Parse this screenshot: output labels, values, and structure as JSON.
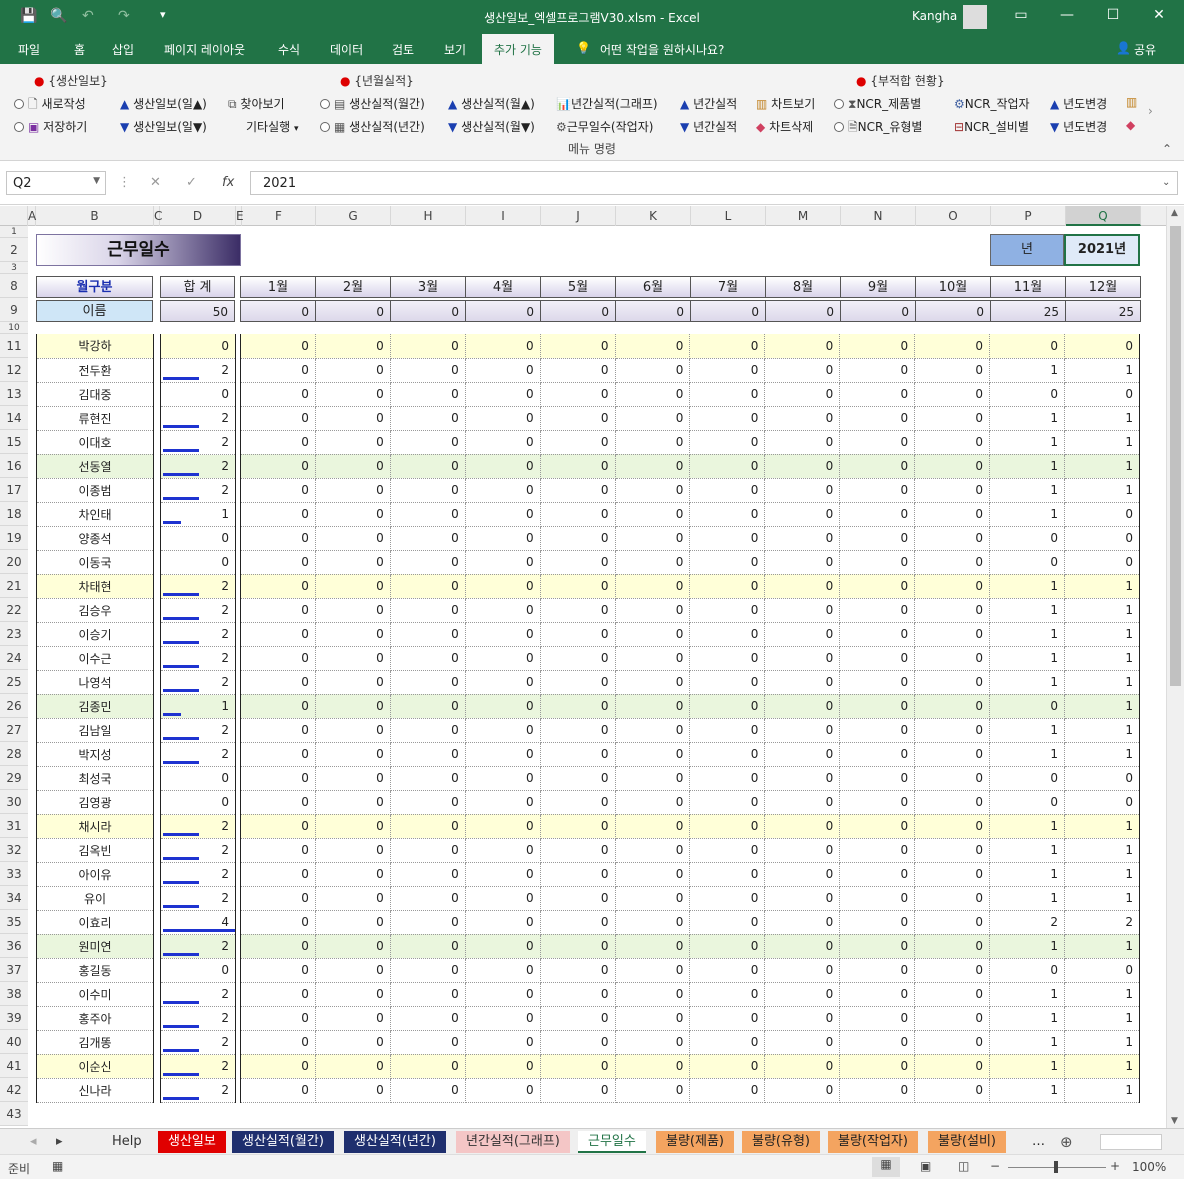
{
  "window": {
    "title": "생산일보_엑셀프로그램V30.xlsm - Excel",
    "user": "Kangha",
    "colors": {
      "excel_green": "#217346",
      "bar_blue": "#1e33d0",
      "highlight_yellow": "#ffffd8",
      "highlight_green": "#eaf6dd"
    }
  },
  "tabs": [
    "파일",
    "홈",
    "삽입",
    "페이지 레이아웃",
    "수식",
    "데이터",
    "검토",
    "보기",
    "추가 기능"
  ],
  "tell_me": "어떤 작업을 원하시나요?",
  "share": "공유",
  "ribbon": {
    "group1_title": "{생산일보}",
    "group2_title": "{년월실적}",
    "group3_title": "{부적합 현황}",
    "new_doc": "새로작성",
    "save": "저장하기",
    "daily_up": "생산일보(일▲)",
    "daily_down": "생산일보(일▼)",
    "find": "찾아보기",
    "other_run": "기타실행",
    "monthly_perf": "생산실적(월간)",
    "yearly_perf": "생산실적(년간)",
    "perf_month_up": "생산실적(월▲)",
    "perf_month_down": "생산실적(월▼)",
    "yearly_graph": "년간실적(그래프)",
    "workdays": "근무일수(작업자)",
    "yearly_up": "년간실적",
    "yearly_down": "년간실적",
    "chart_view": "차트보기",
    "chart_delete": "차트삭제",
    "ncr_product": "NCR_제품별",
    "ncr_type": "NCR_유형별",
    "ncr_worker": "NCR_작업자",
    "ncr_equipment": "NCR_설비별",
    "year_change_up": "년도변경",
    "year_change_down": "년도변경",
    "caption": "메뉴 명령"
  },
  "formula_bar": {
    "name_box": "Q2",
    "value": "2021"
  },
  "columns": [
    "A",
    "B",
    "C",
    "D",
    "E",
    "F",
    "G",
    "H",
    "I",
    "J",
    "K",
    "L",
    "M",
    "N",
    "O",
    "P",
    "Q"
  ],
  "row_numbers": [
    "1",
    "2",
    "3",
    "8",
    "9",
    "10",
    "11",
    "12",
    "13",
    "14",
    "15",
    "16",
    "17",
    "18",
    "19",
    "20",
    "21",
    "22",
    "23",
    "24",
    "25",
    "26",
    "27",
    "28",
    "29",
    "30",
    "31",
    "32",
    "33",
    "34",
    "35",
    "36",
    "37",
    "38",
    "39",
    "40",
    "41",
    "42",
    "43"
  ],
  "sheet": {
    "title": "근무일수",
    "year_label": "년",
    "year_value": "2021년",
    "header_name": "월구분",
    "header_name_sub": "이름",
    "header_total": "합  계",
    "total_sum": "50",
    "months": [
      "1월",
      "2월",
      "3월",
      "4월",
      "5월",
      "6월",
      "7월",
      "8월",
      "9월",
      "10월",
      "11월",
      "12월"
    ],
    "month_totals": [
      "0",
      "0",
      "0",
      "0",
      "0",
      "0",
      "0",
      "0",
      "0",
      "0",
      "25",
      "25"
    ],
    "rows": [
      {
        "name": "박강하",
        "total": 0,
        "nov": 0,
        "dec": 0
      },
      {
        "name": "전두환",
        "total": 2,
        "nov": 1,
        "dec": 1
      },
      {
        "name": "김대중",
        "total": 0,
        "nov": 0,
        "dec": 0
      },
      {
        "name": "류현진",
        "total": 2,
        "nov": 1,
        "dec": 1
      },
      {
        "name": "이대호",
        "total": 2,
        "nov": 1,
        "dec": 1
      },
      {
        "name": "선동열",
        "total": 2,
        "nov": 1,
        "dec": 1
      },
      {
        "name": "이종범",
        "total": 2,
        "nov": 1,
        "dec": 1
      },
      {
        "name": "차인태",
        "total": 1,
        "nov": 1,
        "dec": 0
      },
      {
        "name": "양종석",
        "total": 0,
        "nov": 0,
        "dec": 0
      },
      {
        "name": "이동국",
        "total": 0,
        "nov": 0,
        "dec": 0
      },
      {
        "name": "차태현",
        "total": 2,
        "nov": 1,
        "dec": 1
      },
      {
        "name": "김승우",
        "total": 2,
        "nov": 1,
        "dec": 1
      },
      {
        "name": "이승기",
        "total": 2,
        "nov": 1,
        "dec": 1
      },
      {
        "name": "이수근",
        "total": 2,
        "nov": 1,
        "dec": 1
      },
      {
        "name": "나영석",
        "total": 2,
        "nov": 1,
        "dec": 1
      },
      {
        "name": "김종민",
        "total": 1,
        "nov": 0,
        "dec": 1
      },
      {
        "name": "김남일",
        "total": 2,
        "nov": 1,
        "dec": 1
      },
      {
        "name": "박지성",
        "total": 2,
        "nov": 1,
        "dec": 1
      },
      {
        "name": "최성국",
        "total": 0,
        "nov": 0,
        "dec": 0
      },
      {
        "name": "김영광",
        "total": 0,
        "nov": 0,
        "dec": 0
      },
      {
        "name": "채시라",
        "total": 2,
        "nov": 1,
        "dec": 1
      },
      {
        "name": "김옥빈",
        "total": 2,
        "nov": 1,
        "dec": 1
      },
      {
        "name": "아이유",
        "total": 2,
        "nov": 1,
        "dec": 1
      },
      {
        "name": "유이",
        "total": 2,
        "nov": 1,
        "dec": 1
      },
      {
        "name": "이효리",
        "total": 4,
        "nov": 2,
        "dec": 2
      },
      {
        "name": "원미연",
        "total": 2,
        "nov": 1,
        "dec": 1
      },
      {
        "name": "홍길동",
        "total": 0,
        "nov": 0,
        "dec": 0
      },
      {
        "name": "이수미",
        "total": 2,
        "nov": 1,
        "dec": 1
      },
      {
        "name": "홍주아",
        "total": 2,
        "nov": 1,
        "dec": 1
      },
      {
        "name": "김개똥",
        "total": 2,
        "nov": 1,
        "dec": 1
      },
      {
        "name": "이순신",
        "total": 2,
        "nov": 1,
        "dec": 1
      },
      {
        "name": "신나라",
        "total": 2,
        "nov": 1,
        "dec": 1
      }
    ],
    "highlight_yellow_rows": [
      0,
      10,
      20,
      30
    ],
    "highlight_green_rows": [
      5,
      15,
      25
    ]
  },
  "sheet_tabs": [
    {
      "label": "Help",
      "bg": "#efefef",
      "fg": "#333333"
    },
    {
      "label": "생산일보",
      "bg": "#e00000",
      "fg": "#ffffff"
    },
    {
      "label": "생산실적(월간)",
      "bg": "#1f2f6e",
      "fg": "#ffffff"
    },
    {
      "label": "생산실적(년간)",
      "bg": "#1f2f6e",
      "fg": "#ffffff"
    },
    {
      "label": "년간실적(그래프)",
      "bg": "#f4c6c6",
      "fg": "#333333"
    },
    {
      "label": "근무일수",
      "bg": "#ffffff",
      "fg": "#217346"
    },
    {
      "label": "불량(제품)",
      "bg": "#f4a460",
      "fg": "#222222"
    },
    {
      "label": "불량(유형)",
      "bg": "#f4a460",
      "fg": "#222222"
    },
    {
      "label": "불량(작업자)",
      "bg": "#f4a460",
      "fg": "#222222"
    },
    {
      "label": "불량(설비)",
      "bg": "#f4a460",
      "fg": "#222222"
    }
  ],
  "status": {
    "ready": "준비",
    "zoom": "100%"
  }
}
